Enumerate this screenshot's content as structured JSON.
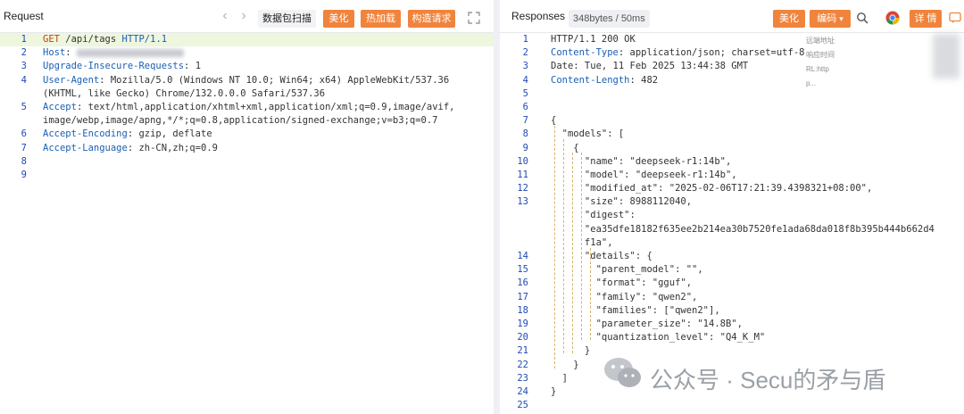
{
  "request": {
    "title": "Request",
    "buttons": {
      "packet_scan": "数据包扫描",
      "beautify": "美化",
      "hot_load": "热加载",
      "build_request": "构造请求"
    },
    "lines": [
      {
        "n": "1",
        "parts": [
          [
            "m",
            "GET"
          ],
          [
            "r",
            " /api/tags "
          ],
          [
            "k",
            "HTTP/1.1"
          ]
        ],
        "hl": true
      },
      {
        "n": "2",
        "parts": [
          [
            "k",
            "Host"
          ],
          [
            "r",
            ": "
          ]
        ],
        "blur": true
      },
      {
        "n": "3",
        "parts": [
          [
            "k",
            "Upgrade-Insecure-Requests"
          ],
          [
            "r",
            ": 1"
          ]
        ]
      },
      {
        "n": "4",
        "parts": [
          [
            "k",
            "User-Agent"
          ],
          [
            "r",
            ": Mozilla/5.0 (Windows NT 10.0; Win64; x64) AppleWebKit/537.36"
          ]
        ]
      },
      {
        "n": "",
        "parts": [
          [
            "r",
            "(KHTML, like Gecko) Chrome/132.0.0.0 Safari/537.36"
          ]
        ]
      },
      {
        "n": "5",
        "parts": [
          [
            "k",
            "Accept"
          ],
          [
            "r",
            ": text/html,application/xhtml+xml,application/xml;q=0.9,image/avif,"
          ]
        ]
      },
      {
        "n": "",
        "parts": [
          [
            "r",
            "image/webp,image/apng,*/*;q=0.8,application/signed-exchange;v=b3;q=0.7"
          ]
        ]
      },
      {
        "n": "6",
        "parts": [
          [
            "k",
            "Accept-Encoding"
          ],
          [
            "r",
            ": gzip, deflate"
          ]
        ]
      },
      {
        "n": "7",
        "parts": [
          [
            "k",
            "Accept-Language"
          ],
          [
            "r",
            ": zh-CN,zh;q=0.9"
          ]
        ]
      },
      {
        "n": "8",
        "parts": []
      },
      {
        "n": "9",
        "parts": []
      }
    ]
  },
  "response": {
    "title": "Responses",
    "badge": "348bytes / 50ms",
    "buttons": {
      "beautify": "美化",
      "encoding": "编码",
      "details": "详 情"
    },
    "side_info": [
      "远端地址",
      "响应时间",
      "RL:http",
      "p..."
    ],
    "lines": [
      {
        "n": "1",
        "parts": [
          [
            "r",
            "HTTP/1.1 200 OK"
          ]
        ]
      },
      {
        "n": "2",
        "parts": [
          [
            "k",
            "Content-Type"
          ],
          [
            "r",
            ": application/json; charset=utf-8"
          ]
        ]
      },
      {
        "n": "3",
        "parts": [
          [
            "r",
            "Date: Tue, 11 Feb 2025 13:44:38 GMT"
          ]
        ]
      },
      {
        "n": "4",
        "parts": [
          [
            "k",
            "Content-Length"
          ],
          [
            "r",
            ": 482"
          ]
        ]
      },
      {
        "n": "5",
        "parts": []
      },
      {
        "n": "6",
        "parts": []
      },
      {
        "n": "7",
        "parts": [
          [
            "r",
            "{"
          ]
        ]
      },
      {
        "n": "8",
        "parts": [
          [
            "r",
            "  \"models\": ["
          ]
        ]
      },
      {
        "n": "9",
        "parts": [
          [
            "r",
            "    {"
          ]
        ]
      },
      {
        "n": "10",
        "parts": [
          [
            "r",
            "      \"name\": \"deepseek-r1:14b\","
          ]
        ]
      },
      {
        "n": "11",
        "parts": [
          [
            "r",
            "      \"model\": \"deepseek-r1:14b\","
          ]
        ]
      },
      {
        "n": "12",
        "parts": [
          [
            "r",
            "      \"modified_at\": \"2025-02-06T17:21:39.4398321+08:00\","
          ]
        ]
      },
      {
        "n": "13",
        "parts": [
          [
            "r",
            "      \"size\": 8988112040,"
          ]
        ]
      },
      {
        "n": "",
        "parts": [
          [
            "r",
            "      \"digest\":"
          ]
        ]
      },
      {
        "n": "",
        "parts": [
          [
            "r",
            "      \"ea35dfe18182f635ee2b214ea30b7520fe1ada68da018f8b395b444b662d4"
          ]
        ]
      },
      {
        "n": "",
        "parts": [
          [
            "r",
            "      f1a\","
          ]
        ]
      },
      {
        "n": "14",
        "parts": [
          [
            "r",
            "      \"details\": {"
          ]
        ]
      },
      {
        "n": "15",
        "parts": [
          [
            "r",
            "        \"parent_model\": \"\","
          ]
        ]
      },
      {
        "n": "16",
        "parts": [
          [
            "r",
            "        \"format\": \"gguf\","
          ]
        ]
      },
      {
        "n": "17",
        "parts": [
          [
            "r",
            "        \"family\": \"qwen2\","
          ]
        ]
      },
      {
        "n": "18",
        "parts": [
          [
            "r",
            "        \"families\": [\"qwen2\"],"
          ]
        ]
      },
      {
        "n": "19",
        "parts": [
          [
            "r",
            "        \"parameter_size\": \"14.8B\","
          ]
        ]
      },
      {
        "n": "20",
        "parts": [
          [
            "r",
            "        \"quantization_level\": \"Q4_K_M\""
          ]
        ]
      },
      {
        "n": "21",
        "parts": [
          [
            "r",
            "      }"
          ]
        ]
      },
      {
        "n": "22",
        "parts": [
          [
            "r",
            "    }"
          ]
        ]
      },
      {
        "n": "23",
        "parts": [
          [
            "r",
            "  ]"
          ]
        ]
      },
      {
        "n": "24",
        "parts": [
          [
            "r",
            "}"
          ]
        ]
      },
      {
        "n": "25",
        "parts": []
      }
    ]
  },
  "watermark": "公众号 · Secu的矛与盾",
  "colors": {
    "accent": "#f0843c",
    "keyword": "#1a5fb4",
    "line_number": "#1f4bb3",
    "highlight": "#eef6dd"
  }
}
